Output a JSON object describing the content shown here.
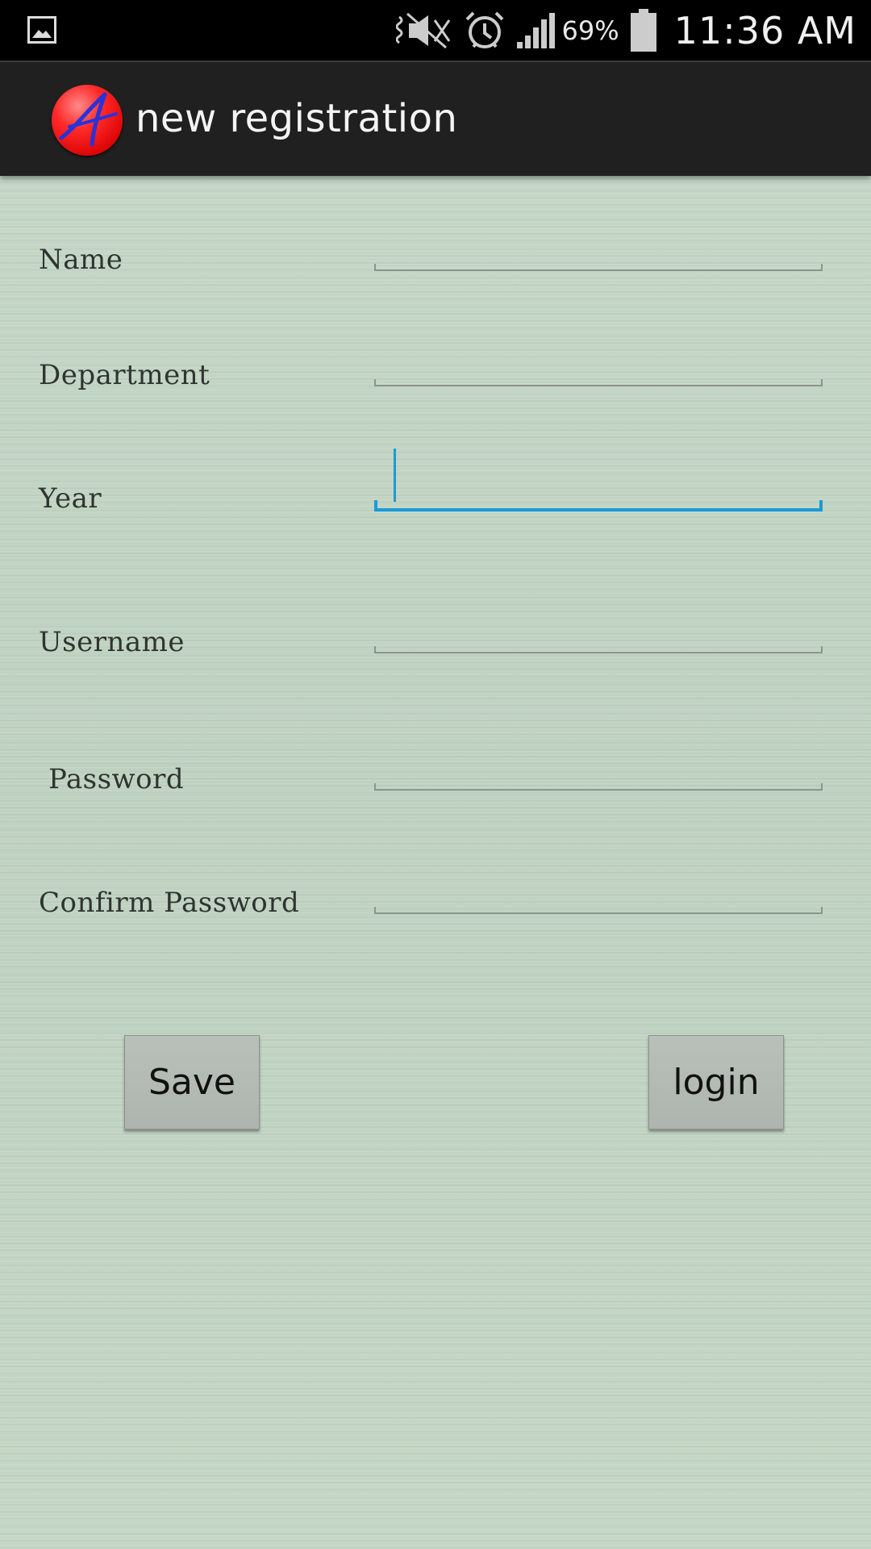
{
  "status_bar": {
    "icons": [
      "gallery-icon",
      "mute-icon",
      "alarm-icon",
      "signal-icon",
      "battery-icon"
    ],
    "battery_percent": "69%",
    "time": "11:36 AM"
  },
  "action_bar": {
    "logo_icon": "app-logo-icon",
    "title": "new registration"
  },
  "form": {
    "fields": [
      {
        "label": "Name",
        "value": "",
        "focused": false
      },
      {
        "label": "Department",
        "value": "",
        "focused": false
      },
      {
        "label": "Year",
        "value": "",
        "focused": true
      },
      {
        "label": "Username",
        "value": "",
        "focused": false
      },
      {
        "label": "Password",
        "value": "",
        "focused": false
      },
      {
        "label": "Confirm Password",
        "value": "",
        "focused": false
      }
    ]
  },
  "buttons": {
    "save_label": "Save",
    "login_label": "login"
  },
  "colors": {
    "background": "#c3d5c4",
    "action_bar": "#202020",
    "focus_accent": "#1a9bd7",
    "logo_red": "#ff2b2b",
    "logo_blue": "#2a32d8"
  }
}
